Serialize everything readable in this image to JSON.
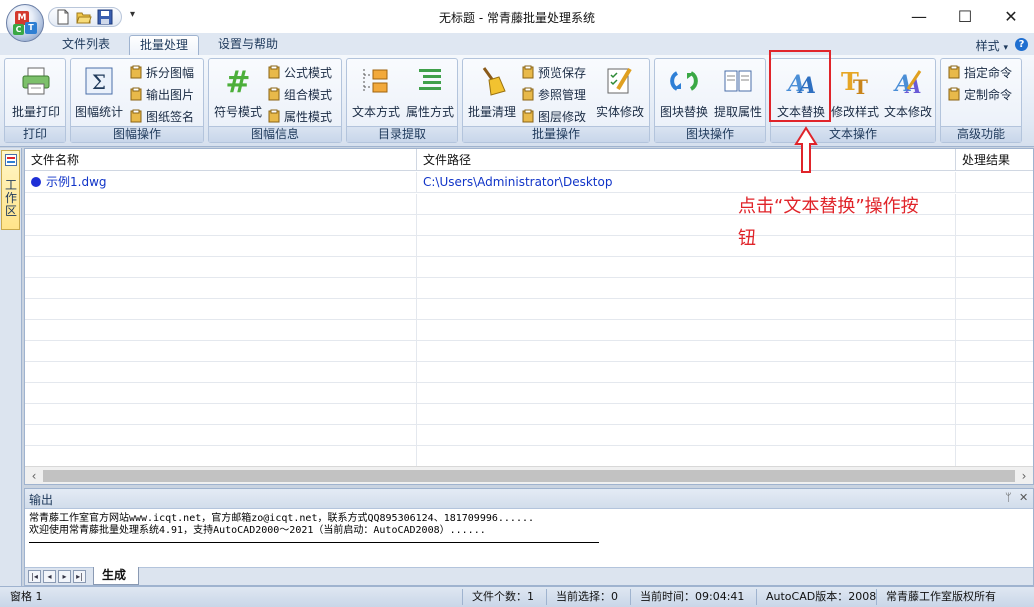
{
  "window": {
    "title": "无标题 - 常青藤批量处理系统",
    "minimize": "—",
    "maximize": "☐",
    "close": "✕"
  },
  "orb": {
    "m": "M",
    "t": "T",
    "c": "C"
  },
  "tabs": [
    {
      "label": "文件列表"
    },
    {
      "label": "批量处理",
      "active": true
    },
    {
      "label": "设置与帮助"
    }
  ],
  "style_menu": "样式",
  "ribbon": {
    "groups": {
      "print": {
        "label": "打印",
        "buttons": {
          "batch_print": "批量打印"
        }
      },
      "frame": {
        "label": "图幅操作",
        "buttons": {
          "stats": "图幅统计",
          "split": "拆分图幅",
          "export_img": "输出图片",
          "sign": "图纸签名"
        }
      },
      "frame_info": {
        "label": "图幅信息",
        "buttons": {
          "symbol": "符号模式",
          "formula": "公式模式",
          "combo": "组合模式",
          "attr": "属性模式"
        }
      },
      "dir": {
        "label": "目录提取",
        "buttons": {
          "text_mode": "文本方式",
          "attr_mode": "属性方式"
        }
      },
      "batch": {
        "label": "批量操作",
        "buttons": {
          "purge": "批量清理",
          "preview": "预览保存",
          "xref": "参照管理",
          "layer": "图层修改",
          "entity": "实体修改"
        }
      },
      "block": {
        "label": "图块操作",
        "buttons": {
          "replace": "图块替换",
          "extract": "提取属性"
        }
      },
      "text": {
        "label": "文本操作",
        "buttons": {
          "replace": "文本替换",
          "style": "修改样式",
          "modify": "文本修改"
        }
      },
      "advanced": {
        "label": "高级功能",
        "buttons": {
          "assign": "指定命令",
          "custom": "定制命令"
        }
      }
    }
  },
  "side_tab": "工作区",
  "table": {
    "columns": [
      "文件名称",
      "文件路径",
      "处理结果"
    ],
    "rows": [
      {
        "name": "示例1.dwg",
        "path": "C:\\Users\\Administrator\\Desktop",
        "result": ""
      }
    ]
  },
  "annotation": "点击“文本替换”操作按钮",
  "output": {
    "title": "输出",
    "pin": "ᛘ",
    "close": "✕",
    "lines": [
      "常青藤工作室官方网站www.icqt.net，官方邮箱zo@icqt.net，联系方式QQ895306124、181709996......",
      "欢迎使用常青藤批量处理系统4.91，支持AutoCAD2000～2021（当前启动：AutoCAD2008）......"
    ],
    "tab": "生成"
  },
  "status": {
    "left": "窗格 1",
    "file_count": "文件个数：1",
    "selection": "当前选择：0",
    "time": "当前时间：09:04:41",
    "autocad": "AutoCAD版本：2008",
    "copyright": "常青藤工作室版权所有"
  },
  "colors": {
    "accent_red": "#e0242a",
    "link_blue": "#1034c8",
    "ribbon_text": "#1e395b"
  }
}
